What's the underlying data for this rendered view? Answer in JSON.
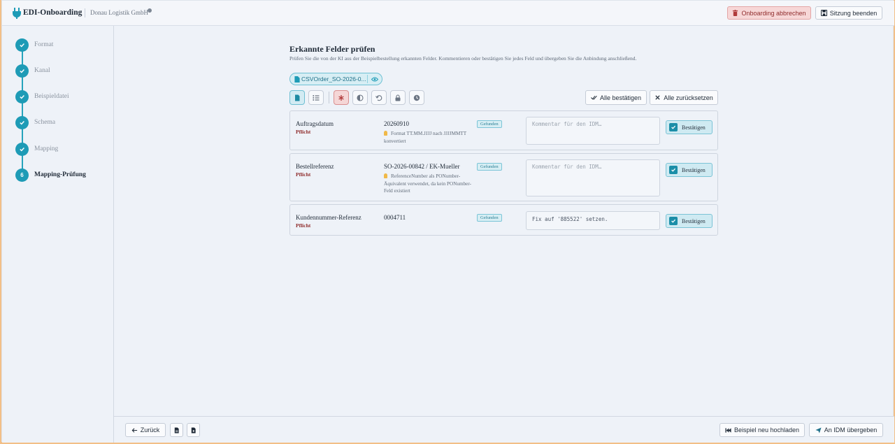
{
  "header": {
    "title": "EDI-Onboarding",
    "company": "Donau Logistik GmbH",
    "cancel_label": "Onboarding abbrechen",
    "end_label": "Sitzung beenden"
  },
  "steps": [
    {
      "label": "Format",
      "state": "done"
    },
    {
      "label": "Kanal",
      "state": "done"
    },
    {
      "label": "Beispieldatei",
      "state": "done"
    },
    {
      "label": "Schema",
      "state": "done"
    },
    {
      "label": "Mapping",
      "state": "done"
    },
    {
      "label": "Mapping-Prüfung",
      "state": "active",
      "number": "6"
    }
  ],
  "main": {
    "title": "Erkannte Felder prüfen",
    "subtitle": "Prüfen Sie die von der KI aus der Beispielbestellung erkannten Felder. Kommentieren oder bestätigen Sie jedes Feld und übergeben Sie die Anbindung anschließend.",
    "file_chip": "CSVOrder_SO-2026-0...",
    "confirm_all": "Alle bestätigen",
    "reset_all": "Alle zurücksetzen"
  },
  "fields": [
    {
      "label": "Auftragsdatum",
      "required": "Pflicht",
      "value": "20260910",
      "note": "Format TT.MM.JJJJ nach JJJJMMTT konvertiert",
      "badge": "Gefunden",
      "comment_placeholder": "Kommentar für den IDM…",
      "comment_value": "",
      "confirm_label": "Bestätigen"
    },
    {
      "label": "Bestellreferenz",
      "required": "Pflicht",
      "value": "SO-2026-00842 / EK-Mueller",
      "note": "ReferenceNumber als PONumber-Äquivalent verwendet, da kein PONumber-Feld existiert",
      "badge": "Gefunden",
      "comment_placeholder": "Kommentar für den IDM…",
      "comment_value": "",
      "confirm_label": "Bestätigen"
    },
    {
      "label": "Kundennummer-Referenz",
      "required": "Pflicht",
      "value": "0004711",
      "note": "",
      "badge": "Gefunden",
      "comment_placeholder": "",
      "comment_value": "Fix auf '885522' setzen.",
      "confirm_label": "Bestätigen"
    }
  ],
  "footer": {
    "back_label": "Zurück",
    "reupload_label": "Beispiel neu hochladen",
    "submit_label": "An IDM übergeben"
  },
  "colors": {
    "accent": "#1e9bb6",
    "danger": "#8f2b2b",
    "background": "#eef2f8"
  }
}
